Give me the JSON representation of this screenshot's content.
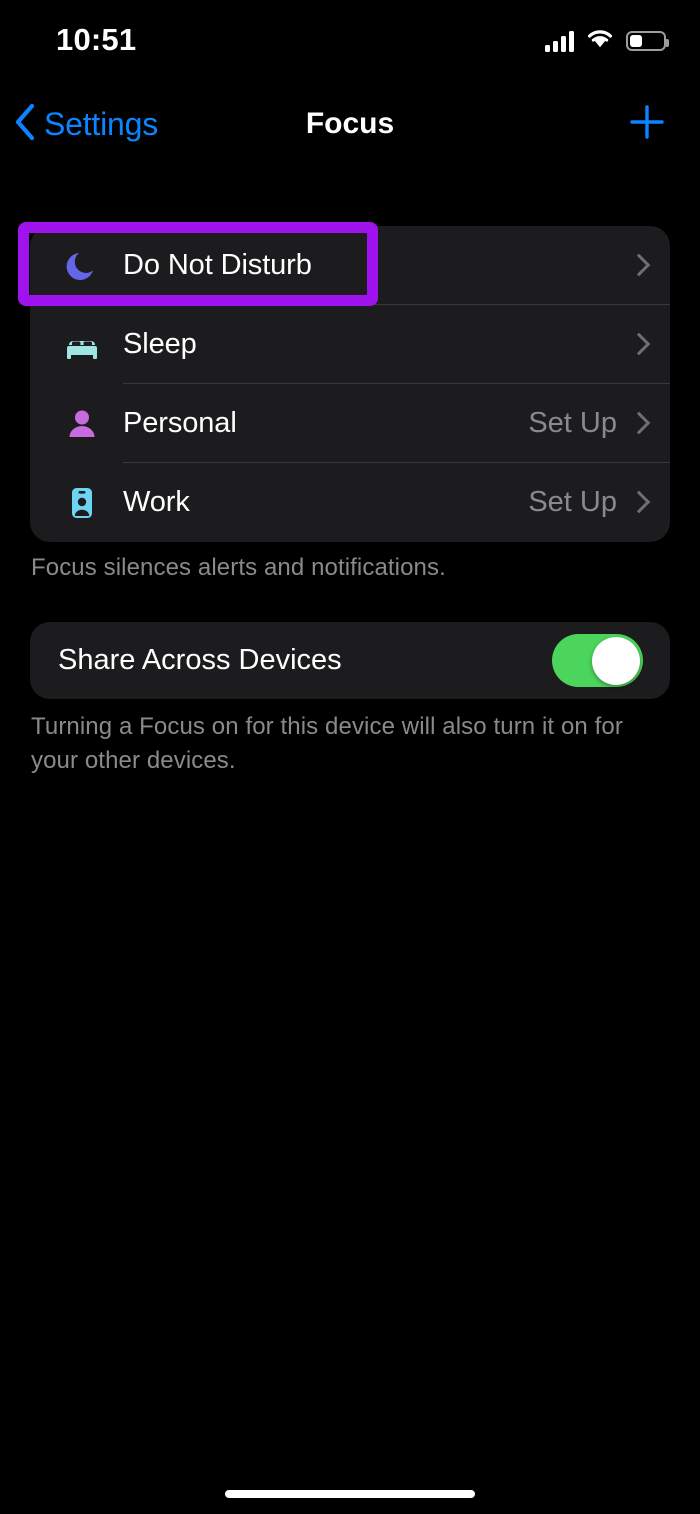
{
  "status_bar": {
    "time": "10:51",
    "cellular_icon": "cellular-signal-icon",
    "wifi_icon": "wifi-icon",
    "battery_icon": "battery-icon",
    "battery_percent": 38
  },
  "nav": {
    "back_label": "Settings",
    "back_icon": "chevron-left-icon",
    "title": "Focus",
    "add_icon": "plus-icon"
  },
  "focus_list": {
    "rows": [
      {
        "label": "Do Not Disturb",
        "icon": "moon-icon",
        "icon_color": "#6366E8",
        "value": "",
        "chevron": "chevron-right-icon",
        "highlighted": true
      },
      {
        "label": "Sleep",
        "icon": "bed-icon",
        "icon_color": "#9FE5E2",
        "value": "",
        "chevron": "chevron-right-icon",
        "highlighted": false
      },
      {
        "label": "Personal",
        "icon": "person-icon",
        "icon_color": "#C86BE0",
        "value": "Set Up",
        "chevron": "chevron-right-icon",
        "highlighted": false
      },
      {
        "label": "Work",
        "icon": "id-badge-icon",
        "icon_color": "#6FD3F2",
        "value": "Set Up",
        "chevron": "chevron-right-icon",
        "highlighted": false
      }
    ],
    "footnote": "Focus silences alerts and notifications."
  },
  "share_section": {
    "label": "Share Across Devices",
    "toggle_state": "on",
    "toggle_color": "#4CD55C",
    "footnote": "Turning a Focus on for this device will also turn it on for your other devices."
  },
  "annotation": {
    "highlight_color": "#A012EE",
    "target": "Do Not Disturb"
  },
  "home_indicator": "home-indicator"
}
